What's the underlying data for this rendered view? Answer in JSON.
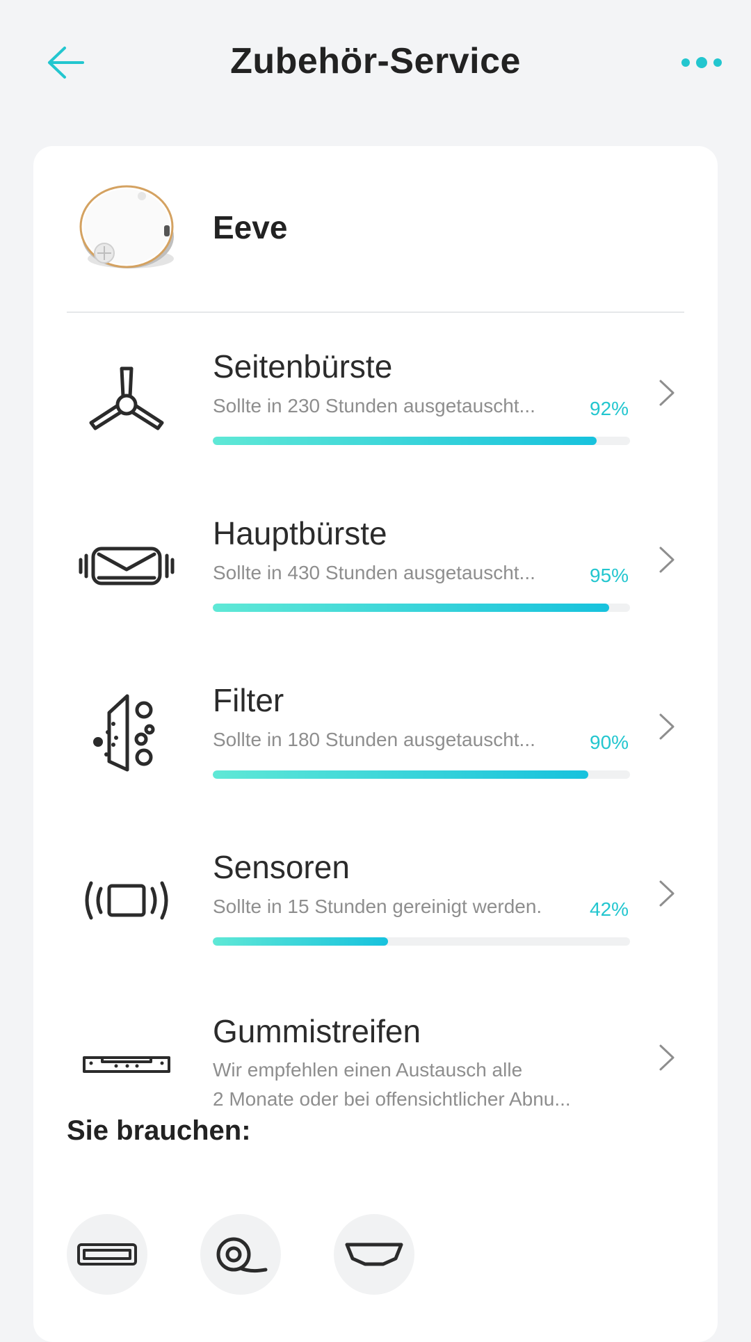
{
  "header": {
    "title": "Zubehör-Service",
    "back_icon": "arrow-left-icon",
    "more_icon": "more-dots-icon",
    "accent_color": "#23c6cf"
  },
  "device": {
    "name": "Eeve",
    "image_icon": "robot-vacuum-image"
  },
  "items": [
    {
      "title": "Seitenbürste",
      "subtitle": "Sollte in 230 Stunden ausgetauscht...",
      "percent_label": "92%",
      "percent": 92,
      "icon": "side-brush-icon"
    },
    {
      "title": "Hauptbürste",
      "subtitle": "Sollte in 430 Stunden ausgetauscht...",
      "percent_label": "95%",
      "percent": 95,
      "icon": "main-brush-icon"
    },
    {
      "title": "Filter",
      "subtitle": "Sollte in 180 Stunden ausgetauscht...",
      "percent_label": "90%",
      "percent": 90,
      "icon": "filter-icon"
    },
    {
      "title": "Sensoren",
      "subtitle": "Sollte in 15 Stunden gereinigt werden.",
      "percent_label": "42%",
      "percent": 42,
      "icon": "sensor-icon"
    },
    {
      "title": "Gummistreifen",
      "subtitle_line1": "Wir empfehlen einen Austausch alle",
      "subtitle_line2": "2 Monate oder bei offensichtlicher Abnu...",
      "icon": "rubber-strip-icon"
    }
  ],
  "needs": {
    "title": "Sie brauchen:",
    "items": [
      {
        "icon": "main-brush-small-icon"
      },
      {
        "icon": "side-brush-wheel-icon"
      },
      {
        "icon": "mop-bracket-icon"
      }
    ]
  }
}
